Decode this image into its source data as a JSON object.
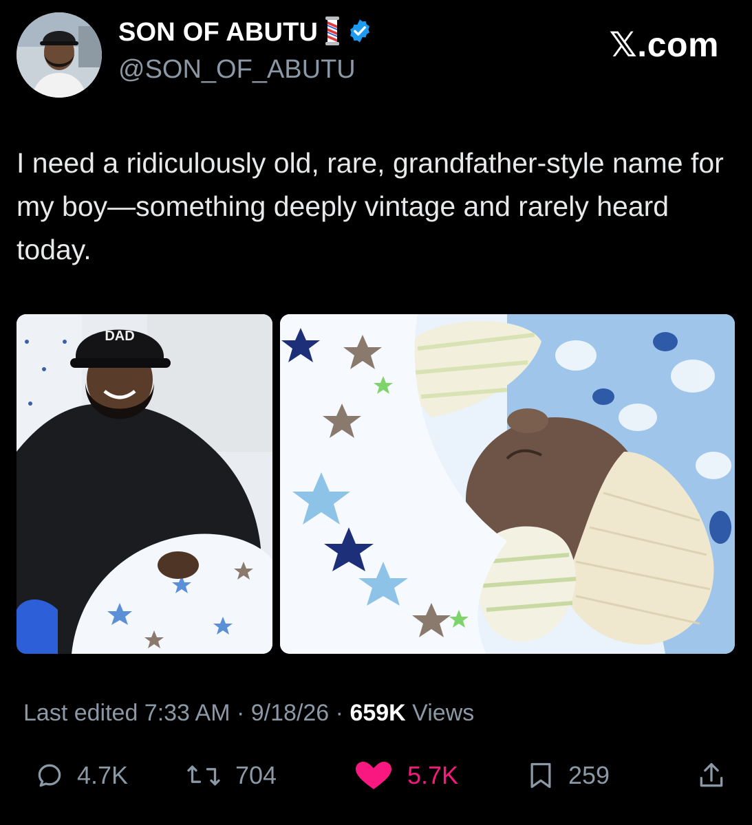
{
  "author": {
    "display_name": "SON OF ABUTU",
    "handle": "@SON_OF_ABUTU",
    "name_emoji": "barber-pole-icon",
    "verified": true,
    "verified_color": "#1d9bf0"
  },
  "brand": "𝕏.com",
  "tweet": {
    "text": "I need a ridiculously old, rare, grandfather-style name for my boy—something deeply vintage and rarely heard today."
  },
  "media": {
    "left_cap_text": "DAD",
    "right_alt": "newborn-baby"
  },
  "meta": {
    "edited_label": "Last edited 7:33 AM",
    "sep1": " · ",
    "date": "9/18/26",
    "sep2": " · ",
    "views_count": "659K",
    "views_label": " Views"
  },
  "actions": {
    "replies": "4.7K",
    "reposts": "704",
    "likes": "5.7K",
    "bookmarks": "259"
  },
  "colors": {
    "background": "#000000",
    "muted": "#8b98a5",
    "like": "#f91880"
  }
}
